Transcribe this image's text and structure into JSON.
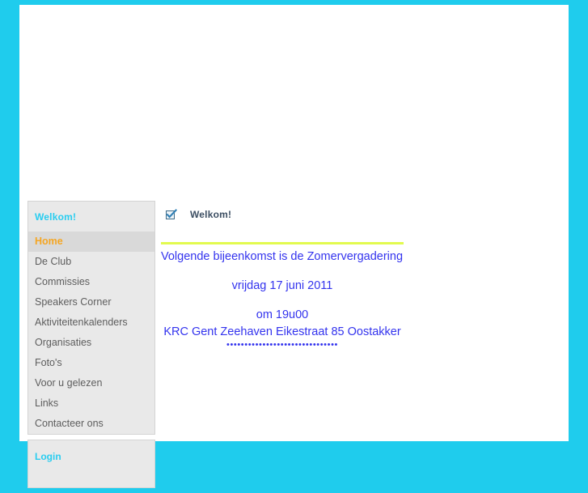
{
  "theme": {
    "frame_color": "#1fcced",
    "page_background": "#ffffff",
    "panel_background": "#e9e9e9",
    "panel_border": "#d4d4d4",
    "active_item_background": "#d9d9d9",
    "accent_cyan": "#29cdf0",
    "accent_orange": "#f5a623",
    "body_text": "#5d5d5d",
    "article_text": "#3333ee",
    "rule_color": "#e2fa4e",
    "heading_text": "#3d4f63"
  },
  "sidebar": {
    "menu_panel": {
      "title": "Welkom!",
      "items": [
        {
          "label": "Home",
          "active": true
        },
        {
          "label": "De Club",
          "active": false
        },
        {
          "label": "Commissies",
          "active": false
        },
        {
          "label": "Speakers Corner",
          "active": false
        },
        {
          "label": "Aktiviteitenkalenders",
          "active": false
        },
        {
          "label": "Organisaties",
          "active": false
        },
        {
          "label": "Foto's",
          "active": false
        },
        {
          "label": "Voor u gelezen",
          "active": false
        },
        {
          "label": "Links",
          "active": false
        },
        {
          "label": "Contacteer ons",
          "active": false
        }
      ]
    },
    "login_panel": {
      "title": "Login"
    }
  },
  "content": {
    "icon_name": "checked-checkbox-icon",
    "heading": "Welkom!",
    "article": {
      "line1": "Volgende bijeenkomst is de Zomervergadering",
      "line2": "vrijdag 17 juni 2011",
      "line3": "om 19u00",
      "line4": "KRC Gent Zeehaven Eikestraat 85 Oostakker",
      "divider": "•••••••••••••••••••••••••••••••"
    }
  }
}
